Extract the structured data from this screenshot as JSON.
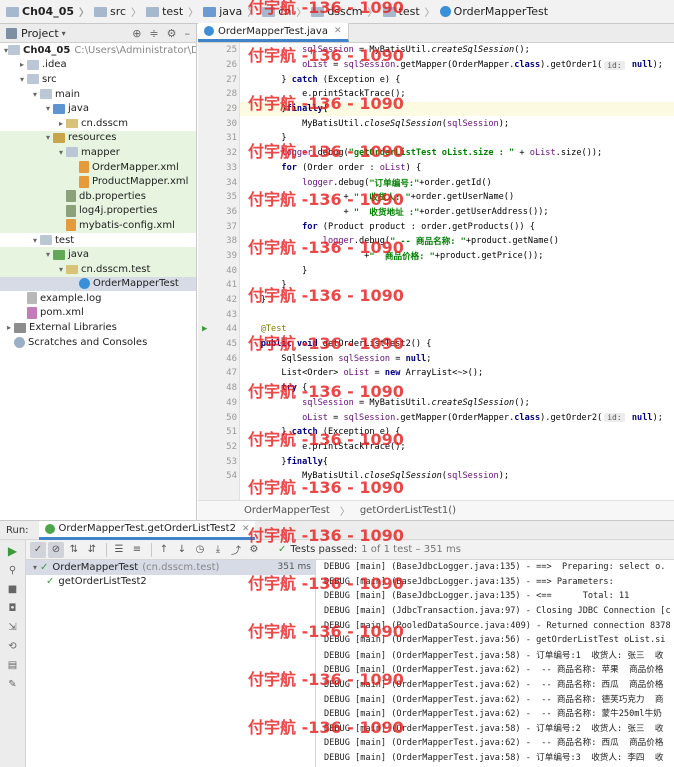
{
  "breadcrumb": [
    "Ch04_05",
    "src",
    "test",
    "java",
    "cn",
    "dsscm",
    "test",
    "OrderMapperTest"
  ],
  "project_panel": {
    "title": "Project",
    "tree": [
      {
        "label": "Ch04_05",
        "extra": "C:\\Users\\Administrator\\Desk",
        "depth": 0,
        "arrow": "▾",
        "icon": "folder"
      },
      {
        "label": ".idea",
        "depth": 1,
        "arrow": "▸",
        "icon": "folder"
      },
      {
        "label": "src",
        "depth": 1,
        "arrow": "▾",
        "icon": "folder"
      },
      {
        "label": "main",
        "depth": 2,
        "arrow": "▾",
        "icon": "folder"
      },
      {
        "label": "java",
        "depth": 3,
        "arrow": "▾",
        "icon": "folder-blue"
      },
      {
        "label": "cn.dsscm",
        "depth": 4,
        "arrow": "▸",
        "icon": "pkg"
      },
      {
        "label": "resources",
        "depth": 3,
        "arrow": "▾",
        "icon": "folder-res",
        "highlight": true
      },
      {
        "label": "mapper",
        "depth": 4,
        "arrow": "▾",
        "icon": "folder",
        "highlight": true
      },
      {
        "label": "OrderMapper.xml",
        "depth": 5,
        "arrow": "",
        "icon": "xml",
        "highlight": true
      },
      {
        "label": "ProductMapper.xml",
        "depth": 5,
        "arrow": "",
        "icon": "xml",
        "highlight": true
      },
      {
        "label": "db.properties",
        "depth": 4,
        "arrow": "",
        "icon": "props",
        "highlight": true
      },
      {
        "label": "log4j.properties",
        "depth": 4,
        "arrow": "",
        "icon": "props",
        "highlight": true
      },
      {
        "label": "mybatis-config.xml",
        "depth": 4,
        "arrow": "",
        "icon": "xml",
        "highlight": true
      },
      {
        "label": "test",
        "depth": 2,
        "arrow": "▾",
        "icon": "folder"
      },
      {
        "label": "java",
        "depth": 3,
        "arrow": "▾",
        "icon": "folder-green",
        "highlight": true
      },
      {
        "label": "cn.dsscm.test",
        "depth": 4,
        "arrow": "▾",
        "icon": "pkg",
        "highlight": true
      },
      {
        "label": "OrderMapperTest",
        "depth": 5,
        "arrow": "",
        "icon": "testclass",
        "selected": true
      },
      {
        "label": "example.log",
        "depth": 1,
        "arrow": "",
        "icon": "file"
      },
      {
        "label": "pom.xml",
        "depth": 1,
        "arrow": "",
        "icon": "maven"
      },
      {
        "label": "External Libraries",
        "depth": 0,
        "arrow": "▸",
        "icon": "lib"
      },
      {
        "label": "Scratches and Consoles",
        "depth": 0,
        "arrow": "",
        "icon": "scratch"
      }
    ]
  },
  "editor": {
    "tab_label": "OrderMapperTest.java",
    "line_numbers": [
      "25",
      "26",
      "27",
      "28",
      "29",
      "30",
      "31",
      "32",
      "33",
      "34",
      "35",
      "36",
      "37",
      "38",
      "39",
      "40",
      "41",
      "42",
      "43",
      "44",
      "45",
      "46",
      "47",
      "48",
      "49",
      "50",
      "51",
      "52",
      "53",
      "54"
    ],
    "code_lines": [
      [
        {
          "t": "            "
        },
        {
          "t": "sqlSession",
          "c": "var"
        },
        {
          "t": " = MyBatisUtil."
        },
        {
          "t": "createSqlSession",
          "c": "fn"
        },
        {
          "t": "();"
        }
      ],
      [
        {
          "t": "            "
        },
        {
          "t": "oList",
          "c": "var"
        },
        {
          "t": " = "
        },
        {
          "t": "sqlSession",
          "c": "var"
        },
        {
          "t": ".getMapper(OrderMapper."
        },
        {
          "t": "class",
          "c": "kw"
        },
        {
          "t": ").getOrder1("
        },
        {
          "t": "id:",
          "c": "hint"
        },
        {
          "t": " "
        },
        {
          "t": "null",
          "c": "kw"
        },
        {
          "t": ");"
        }
      ],
      [
        {
          "t": "        } "
        },
        {
          "t": "catch",
          "c": "kw"
        },
        {
          "t": " (Exception e) {"
        }
      ],
      [
        {
          "t": "            e.printStackTrace();"
        }
      ],
      [
        {
          "t": "        }"
        },
        {
          "t": "finally",
          "c": "kw"
        },
        {
          "t": "{"
        }
      ],
      [
        {
          "t": "            MyBatisUtil."
        },
        {
          "t": "closeSqlSession",
          "c": "fn"
        },
        {
          "t": "("
        },
        {
          "t": "sqlSession",
          "c": "var"
        },
        {
          "t": ");"
        }
      ],
      [
        {
          "t": "        }"
        }
      ],
      [
        {
          "t": "        "
        },
        {
          "t": "logger",
          "c": "var"
        },
        {
          "t": ".debug("
        },
        {
          "t": "\"getOrderListTest oList.size : \"",
          "c": "str"
        },
        {
          "t": " + "
        },
        {
          "t": "oList",
          "c": "var"
        },
        {
          "t": ".size());"
        }
      ],
      [
        {
          "t": "        "
        },
        {
          "t": "for",
          "c": "kw"
        },
        {
          "t": " (Order order : "
        },
        {
          "t": "oList",
          "c": "var"
        },
        {
          "t": ") {"
        }
      ],
      [
        {
          "t": "            "
        },
        {
          "t": "logger",
          "c": "var"
        },
        {
          "t": ".debug("
        },
        {
          "t": "\"订单编号:\"",
          "c": "str"
        },
        {
          "t": "+order.getId()"
        }
      ],
      [
        {
          "t": "                    + "
        },
        {
          "t": "\"  收货人: \"",
          "c": "str"
        },
        {
          "t": "+order.getUserName()"
        }
      ],
      [
        {
          "t": "                    + "
        },
        {
          "t": "\"  收货地址 :\"",
          "c": "str"
        },
        {
          "t": "+order.getUserAddress());"
        }
      ],
      [
        {
          "t": "            "
        },
        {
          "t": "for",
          "c": "kw"
        },
        {
          "t": " (Product product : order.getProducts()) {"
        }
      ],
      [
        {
          "t": "                "
        },
        {
          "t": "logger",
          "c": "var"
        },
        {
          "t": ".debug("
        },
        {
          "t": "\" -- 商品名称: \"",
          "c": "str"
        },
        {
          "t": "+product.getName()"
        }
      ],
      [
        {
          "t": "                        +"
        },
        {
          "t": "\"  商品价格: \"",
          "c": "str"
        },
        {
          "t": "+product.getPrice());"
        }
      ],
      [
        {
          "t": "            }"
        }
      ],
      [
        {
          "t": "        }"
        }
      ],
      [
        {
          "t": "    }"
        }
      ],
      [
        {
          "t": ""
        }
      ],
      [
        {
          "t": "    "
        },
        {
          "t": "@Test",
          "c": "ann"
        }
      ],
      [
        {
          "t": "    "
        },
        {
          "t": "public void",
          "c": "kw"
        },
        {
          "t": " getOrderListTest2() {"
        }
      ],
      [
        {
          "t": "        SqlSession "
        },
        {
          "t": "sqlSession",
          "c": "var"
        },
        {
          "t": " = "
        },
        {
          "t": "null",
          "c": "kw"
        },
        {
          "t": ";"
        }
      ],
      [
        {
          "t": "        List<Order> "
        },
        {
          "t": "oList",
          "c": "var"
        },
        {
          "t": " = "
        },
        {
          "t": "new",
          "c": "kw"
        },
        {
          "t": " ArrayList<~>();"
        }
      ],
      [
        {
          "t": "        "
        },
        {
          "t": "try",
          "c": "kw"
        },
        {
          "t": " {"
        }
      ],
      [
        {
          "t": "            "
        },
        {
          "t": "sqlSession",
          "c": "var"
        },
        {
          "t": " = MyBatisUtil."
        },
        {
          "t": "createSqlSession",
          "c": "fn"
        },
        {
          "t": "();"
        }
      ],
      [
        {
          "t": "            "
        },
        {
          "t": "oList",
          "c": "var"
        },
        {
          "t": " = "
        },
        {
          "t": "sqlSession",
          "c": "var"
        },
        {
          "t": ".getMapper(OrderMapper."
        },
        {
          "t": "class",
          "c": "kw"
        },
        {
          "t": ").getOrder2("
        },
        {
          "t": "id:",
          "c": "hint"
        },
        {
          "t": " "
        },
        {
          "t": "null",
          "c": "kw"
        },
        {
          "t": ");"
        }
      ],
      [
        {
          "t": "        } "
        },
        {
          "t": "catch",
          "c": "kw"
        },
        {
          "t": " (Exception e) {"
        }
      ],
      [
        {
          "t": "            e.printStackTrace();"
        }
      ],
      [
        {
          "t": "        }"
        },
        {
          "t": "finally",
          "c": "kw"
        },
        {
          "t": "{"
        }
      ],
      [
        {
          "t": "            MyBatisUtil."
        },
        {
          "t": "closeSqlSession",
          "c": "fn"
        },
        {
          "t": "("
        },
        {
          "t": "sqlSession",
          "c": "var"
        },
        {
          "t": ");"
        }
      ]
    ],
    "highlight_line": "29",
    "run_gutter_line": "44",
    "breadcrumbs": [
      "OrderMapperTest",
      "getOrderListTest1()"
    ]
  },
  "run_panel": {
    "label": "Run:",
    "tab_label": "OrderMapperTest.getOrderListTest2",
    "passed_label": "Tests passed:",
    "passed_detail": "1 of 1 test – 351 ms",
    "tests": [
      {
        "name": "OrderMapperTest",
        "extra": "(cn.dsscm.test)",
        "time": "351 ms",
        "depth": 0,
        "selected": true
      },
      {
        "name": "getOrderListTest2",
        "extra": "",
        "time": "",
        "depth": 1,
        "selected": false
      }
    ],
    "console_lines": [
      "DEBUG [main] (BaseJdbcLogger.java:135) - ==>  Preparing: select o.",
      "DEBUG [main] (BaseJdbcLogger.java:135) - ==> Parameters: ",
      "DEBUG [main] (BaseJdbcLogger.java:135) - <==      Total: 11",
      "DEBUG [main] (JdbcTransaction.java:97) - Closing JDBC Connection [c",
      "DEBUG [main] (PooledDataSource.java:409) - Returned connection 8378",
      "DEBUG [main] (OrderMapperTest.java:56) - getOrderListTest oList.si",
      "DEBUG [main] (OrderMapperTest.java:58) - 订单编号:1  收货人: 张三  收",
      "DEBUG [main] (OrderMapperTest.java:62) -  -- 商品名称: 苹果  商品价格",
      "DEBUG [main] (OrderMapperTest.java:62) -  -- 商品名称: 西瓜  商品价格",
      "DEBUG [main] (OrderMapperTest.java:62) -  -- 商品名称: 德芙巧克力  商",
      "DEBUG [main] (OrderMapperTest.java:62) -  -- 商品名称: 蒙牛250ml牛奶",
      "DEBUG [main] (OrderMapperTest.java:58) - 订单编号:2  收货人: 张三  收",
      "DEBUG [main] (OrderMapperTest.java:62) -  -- 商品名称: 西瓜  商品价格",
      "DEBUG [main] (OrderMapperTest.java:58) - 订单编号:3  收货人: 李四  收"
    ]
  },
  "watermark": "付宇航 -136 - 1090",
  "colors": {
    "accent": "#4083c9",
    "pass_green": "#3a9a3a",
    "watermark_red": "#e61e1e"
  }
}
